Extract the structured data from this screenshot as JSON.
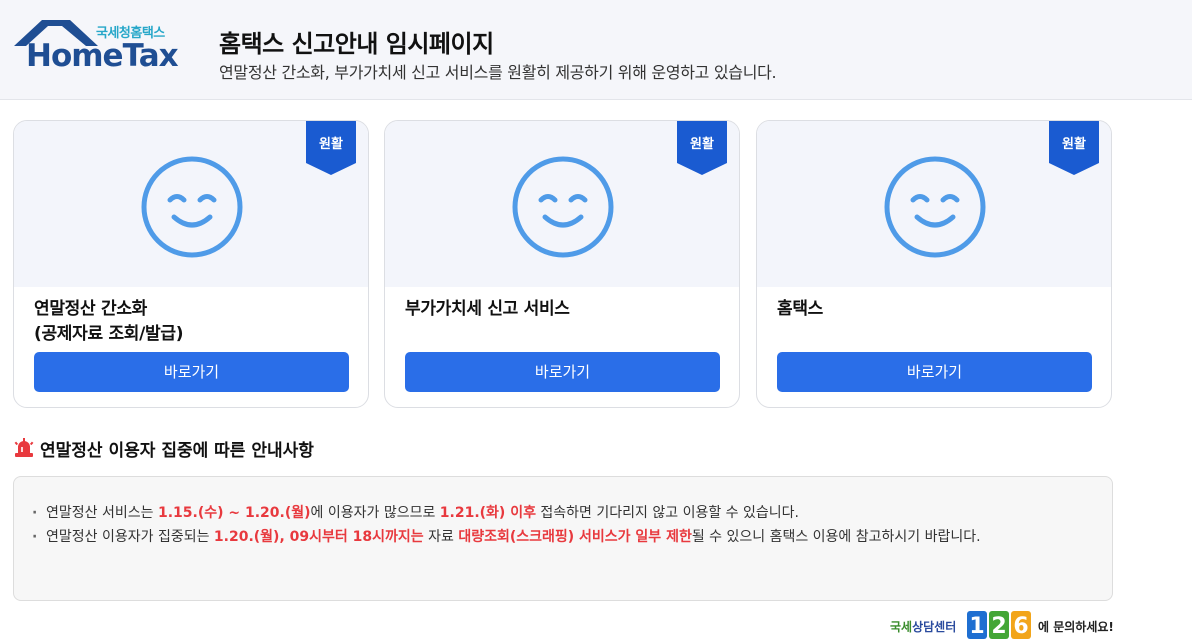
{
  "header": {
    "logo_sub": "국세청홈택스",
    "logo_main": "HomeTax",
    "title": "홈택스 신고안내 임시페이지",
    "subtitle": "연말정산 간소화, 부가가치세 신고 서비스를 원활히 제공하기 위해 운영하고 있습니다."
  },
  "cards": [
    {
      "badge": "원활",
      "title_line1": "연말정산 간소화",
      "title_line2": "(공제자료 조회/발급)",
      "button": "바로가기"
    },
    {
      "badge": "원활",
      "title_line1": "부가가치세 신고 서비스",
      "title_line2": "",
      "button": "바로가기"
    },
    {
      "badge": "원활",
      "title_line1": "홈택스",
      "title_line2": "",
      "button": "바로가기"
    }
  ],
  "notice": {
    "title": "연말정산 이용자 집중에 따른 안내사항",
    "item1": {
      "p1": "연말정산 서비스는 ",
      "h1": "1.15.(수) ~ 1.20.(월)",
      "p2": "에 이용자가 많으므로 ",
      "h2": "1.21.(화) 이후",
      "p3": " 접속하면 기다리지 않고 이용할 수 있습니다."
    },
    "item2": {
      "p1": "연말정산 이용자가 집중되는 ",
      "h1": "1.20.(월), 09시부터 18시까지는",
      "p2": " 자료 ",
      "h2": "대량조회(스크래핑) 서비스가 일부 제한",
      "p3": "될 수 있으니 홈택스 이용에 참고하시기 바랍니다."
    }
  },
  "footer": {
    "prefix_green": "국세",
    "prefix_blue": "상담센터",
    "number": "126",
    "suffix": "에 문의하세요!"
  },
  "colors": {
    "primary_button": "#2a6ee8",
    "badge": "#1a5bd1",
    "smile": "#4f9be8",
    "highlight": "#e8393e"
  },
  "icons": {
    "status": "smile-icon",
    "badge": "ribbon-badge-icon",
    "notice": "siren-icon"
  }
}
